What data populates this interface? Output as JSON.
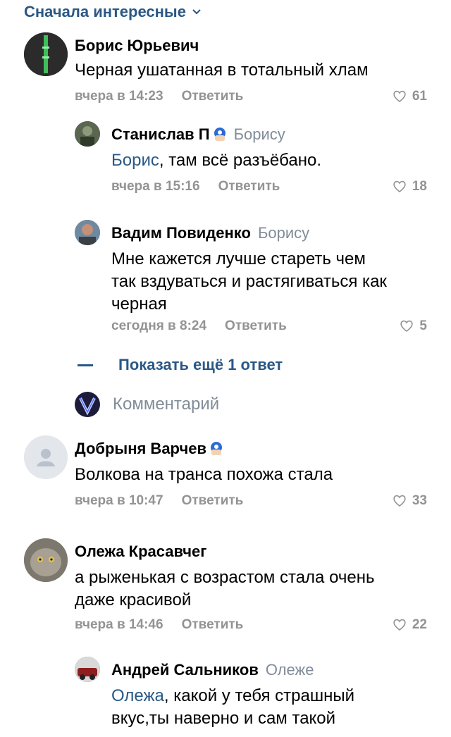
{
  "sort": {
    "label": "Сначала интересные"
  },
  "comments": [
    {
      "name": "Борис Юрьевич",
      "text": "Черная ушатанная в тотальный хлам",
      "time": "вчера в 14:23",
      "reply": "Ответить",
      "likes": "61"
    },
    {
      "name": "Станислав П",
      "reply_to": "Борису",
      "mention": "Борис",
      "text": ", там всё разъёбано.",
      "time": "вчера в 15:16",
      "reply": "Ответить",
      "likes": "18"
    },
    {
      "name": "Вадим Повиденко",
      "reply_to": "Борису",
      "text_lines": [
        "Мне кажется лучше стареть чем",
        "так вздуваться и растягиваться как",
        "черная"
      ],
      "time": "сегодня в 8:24",
      "reply": "Ответить",
      "likes": "5"
    },
    {
      "name": "Добрыня Варчев",
      "text": "Волкова на транса похожа стала",
      "time": "вчера в 10:47",
      "reply": "Ответить",
      "likes": "33"
    },
    {
      "name": "Олежа Красавчег",
      "text_lines": [
        "а рыженькая с возрастом стала очень",
        "даже красивой"
      ],
      "time": "вчера в 14:46",
      "reply": "Ответить",
      "likes": "22"
    },
    {
      "name": "Андрей Сальников",
      "reply_to": "Олеже",
      "mention": "Олежа",
      "text_lines": [
        ", какой у тебя страшный",
        "вкус,ты наверно и сам такой"
      ]
    }
  ],
  "show_more": {
    "label": "Показать ещё 1 ответ"
  },
  "composer": {
    "placeholder": "Комментарий"
  },
  "colors": {
    "link": "#2a5885",
    "meta": "#939393",
    "secondary": "#818c99"
  }
}
